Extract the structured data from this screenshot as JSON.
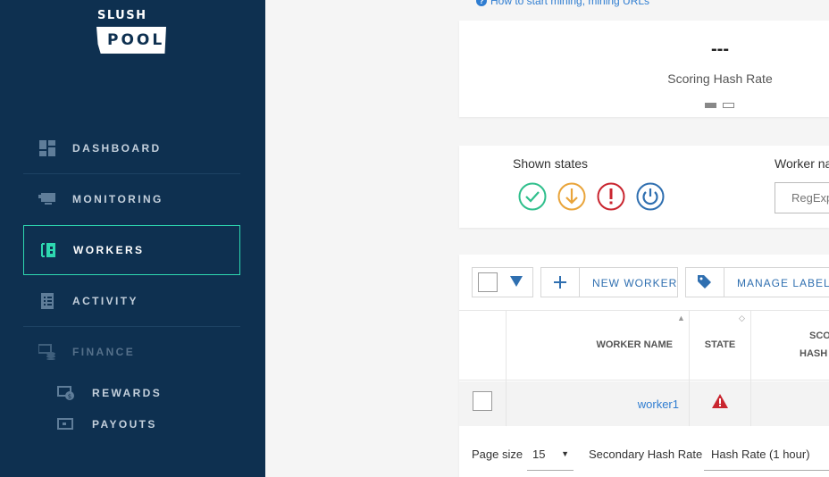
{
  "sidebar": {
    "logo_top": "SLUSH",
    "logo_bottom": "POOL",
    "items": [
      {
        "label": "DASHBOARD"
      },
      {
        "label": "MONITORING"
      },
      {
        "label": "WORKERS"
      },
      {
        "label": "ACTIVITY"
      },
      {
        "label": "FINANCE"
      }
    ],
    "sub_items": [
      {
        "label": "REWARDS"
      },
      {
        "label": "PAYOUTS"
      }
    ]
  },
  "help_link": "How to start mining, mining URLs",
  "scoring": {
    "value": "---",
    "label": "Scoring Hash Rate"
  },
  "filters": {
    "shown_states_label": "Shown states",
    "worker_name_label": "Worker na",
    "regexp_placeholder": "RegExp"
  },
  "toolbar": {
    "new_worker": "NEW WORKER",
    "manage_labels": "MANAGE LABELS"
  },
  "table": {
    "columns": [
      "WORKER NAME",
      "STATE",
      "SCO",
      "HASH"
    ],
    "rows": [
      {
        "name": "worker1",
        "state": "warning"
      }
    ]
  },
  "footer": {
    "page_size_label": "Page size",
    "page_size_value": "15",
    "secondary_label": "Secondary Hash Rate",
    "secondary_value": "Hash Rate (1 hour)"
  },
  "colors": {
    "sidebar": "#0e3050",
    "accent": "#2ed8b0",
    "link": "#2f7dd1",
    "ok": "#2fbf8c",
    "warn": "#e9a43a",
    "error": "#c9252f",
    "off": "#2f6fb0"
  }
}
